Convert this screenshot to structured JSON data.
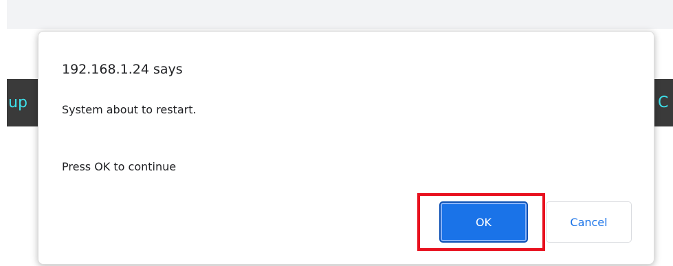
{
  "background": {
    "nav_left_text": "up",
    "nav_right_text": "C",
    "nav_text_color": "#3ee0ea",
    "nav_bg_color": "#3a3a3a"
  },
  "dialog": {
    "title": "192.168.1.24 says",
    "message_line1": "System about to restart.",
    "message_line2": "Press OK to continue",
    "ok_label": "OK",
    "cancel_label": "Cancel",
    "accent_color": "#1a73e8",
    "highlight_color": "#e8101e"
  }
}
